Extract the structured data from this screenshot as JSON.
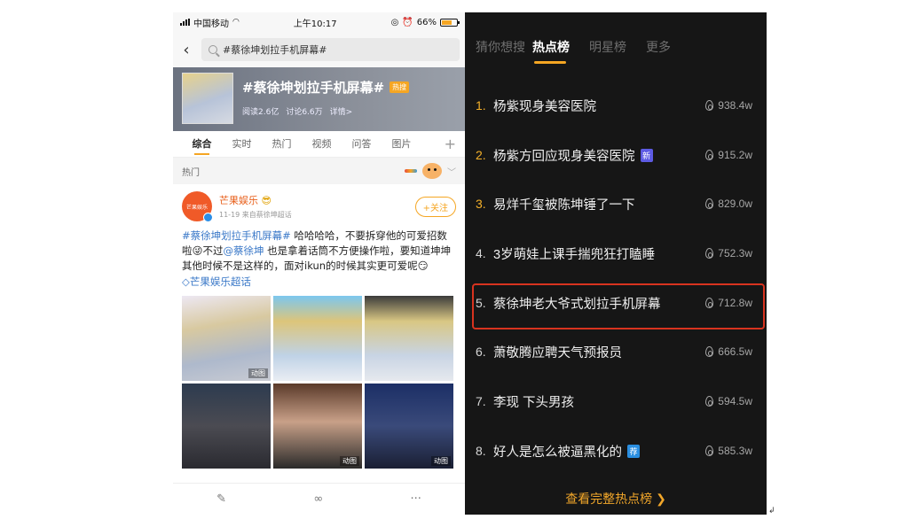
{
  "left": {
    "status": {
      "carrier": "中国移动",
      "time": "上午10:17",
      "battery": "66%"
    },
    "search": {
      "query": "#蔡徐坤划拉手机屏幕#"
    },
    "banner": {
      "title": "#蔡徐坤划拉手机屏幕#",
      "badge": "热搜",
      "reads": "阅读2.6亿",
      "discussions": "讨论6.6万",
      "details": "详情>"
    },
    "tabs": [
      "综合",
      "实时",
      "热门",
      "视频",
      "问答",
      "图片"
    ],
    "tabs_plus": "+",
    "hot_section": "热门",
    "post": {
      "author": "芒果娱乐",
      "avatar_text": "芒果娱乐",
      "date": "11-19",
      "source": "来自蔡徐坤超话",
      "follow": "+关注",
      "hashtag": "#蔡徐坤划拉手机屏幕#",
      "text1": " 哈哈哈哈，不要拆穿他的可爱招数啦",
      "emoji1": "😜",
      "text2": "不过",
      "mention": "@蔡徐坤",
      "text3": " 也是拿着话筒不方便操作啦，要知道坤坤其他时候不是这样的，面对ikun的时候其实更可爱呢",
      "emoji2": "😏",
      "supertopic": "芒果娱乐超话",
      "gif_label": "动图"
    }
  },
  "right": {
    "tabs": [
      "猜你想搜",
      "热点榜",
      "明星榜",
      "更多"
    ],
    "items": [
      {
        "rank": "1.",
        "text": "杨紫现身美容医院",
        "tag": "",
        "heat": "938.4w"
      },
      {
        "rank": "2.",
        "text": "杨紫方回应现身美容医院",
        "tag": "新",
        "heat": "915.2w"
      },
      {
        "rank": "3.",
        "text": "易烊千玺被陈坤锤了一下",
        "tag": "",
        "heat": "829.0w"
      },
      {
        "rank": "4.",
        "text": "3岁萌娃上课手揣兜狂打瞌睡",
        "tag": "",
        "heat": "752.3w"
      },
      {
        "rank": "5.",
        "text": "蔡徐坤老大爷式划拉手机屏幕",
        "tag": "",
        "heat": "712.8w"
      },
      {
        "rank": "6.",
        "text": "萧敬腾应聘天气预报员",
        "tag": "",
        "heat": "666.5w"
      },
      {
        "rank": "7.",
        "text": "李现 下头男孩",
        "tag": "",
        "heat": "594.5w"
      },
      {
        "rank": "8.",
        "text": "好人是怎么被逼黑化的",
        "tag": "荐",
        "heat": "585.3w"
      }
    ],
    "see_all": "查看完整热点榜 ❯"
  },
  "colors": {
    "accent": "#f5a623",
    "highlight_border": "#d8331f",
    "link": "#3a78c8"
  }
}
